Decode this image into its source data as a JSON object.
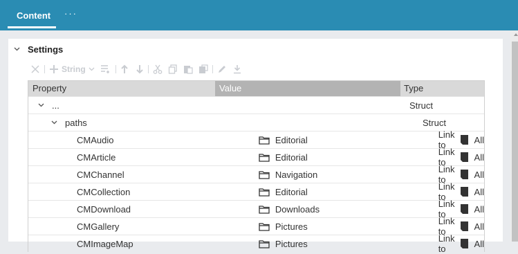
{
  "header": {
    "tab_label": "Content",
    "more_label": "···"
  },
  "settings": {
    "title": "Settings",
    "expanded": true
  },
  "toolbar": {
    "type_label": "String"
  },
  "table": {
    "columns": [
      "Property",
      "Value",
      "Type"
    ],
    "rows": [
      {
        "property": "...",
        "value": "",
        "type": "Struct"
      },
      {
        "property": "paths",
        "value": "",
        "type": "Struct"
      },
      {
        "property": "CMAudio",
        "value": "Editorial",
        "type_prefix": "Link to",
        "type_suffix": "All"
      },
      {
        "property": "CMArticle",
        "value": "Editorial",
        "type_prefix": "Link to",
        "type_suffix": "All"
      },
      {
        "property": "CMChannel",
        "value": "Navigation",
        "type_prefix": "Link to",
        "type_suffix": "All"
      },
      {
        "property": "CMCollection",
        "value": "Editorial",
        "type_prefix": "Link to",
        "type_suffix": "All"
      },
      {
        "property": "CMDownload",
        "value": "Downloads",
        "type_prefix": "Link to",
        "type_suffix": "All"
      },
      {
        "property": "CMGallery",
        "value": "Pictures",
        "type_prefix": "Link to",
        "type_suffix": "All"
      },
      {
        "property": "CMImageMap",
        "value": "Pictures",
        "type_prefix": "Link to",
        "type_suffix": "All"
      }
    ]
  },
  "colors": {
    "header_bg": "#2a8cb3",
    "value_header_bg": "#b3b3b3",
    "toolbar_disabled": "#c9ccd1"
  }
}
